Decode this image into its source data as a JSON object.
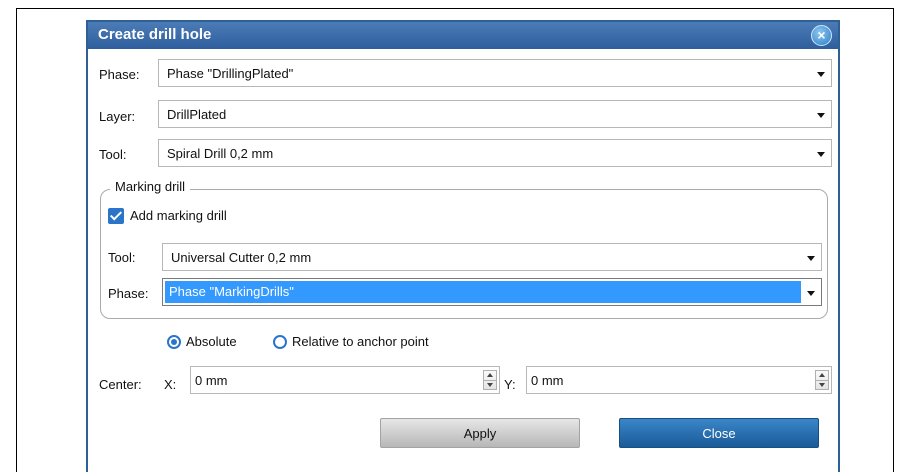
{
  "dialog": {
    "title": "Create drill hole",
    "close_glyph": "×"
  },
  "fields": {
    "phase": {
      "label": "Phase:",
      "value": "Phase \"DrillingPlated\""
    },
    "layer": {
      "label": "Layer:",
      "value": "DrillPlated"
    },
    "tool": {
      "label": "Tool:",
      "value": "Spiral Drill  0,2 mm"
    }
  },
  "marking": {
    "legend": "Marking drill",
    "checkbox_label": "Add marking drill",
    "checked": true,
    "tool": {
      "label": "Tool:",
      "value": "Universal Cutter 0,2 mm"
    },
    "phase": {
      "label": "Phase:",
      "value": "Phase \"MarkingDrills\""
    }
  },
  "positioning": {
    "options": [
      "Absolute",
      "Relative to anchor point"
    ],
    "selected": "Absolute"
  },
  "center": {
    "label": "Center:",
    "x_label": "X:",
    "x_value": "0 mm",
    "y_label": "Y:",
    "y_value": "0 mm"
  },
  "buttons": {
    "apply": "Apply",
    "close": "Close"
  }
}
